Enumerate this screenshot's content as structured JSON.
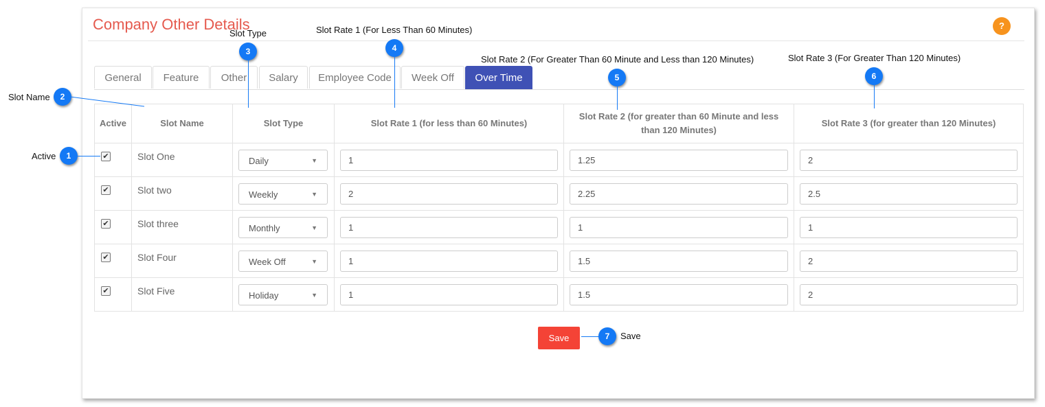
{
  "page": {
    "title": "Company Other Details",
    "help_label": "?"
  },
  "tabs": [
    {
      "label": "General",
      "active": false
    },
    {
      "label": "Feature",
      "active": false
    },
    {
      "label": "Other",
      "active": false
    },
    {
      "label": "Salary",
      "active": false
    },
    {
      "label": "Employee Code",
      "active": false
    },
    {
      "label": "Week Off",
      "active": false
    },
    {
      "label": "Over Time",
      "active": true
    }
  ],
  "table": {
    "headers": {
      "active": "Active",
      "slot_name": "Slot Name",
      "slot_type": "Slot Type",
      "rate1": "Slot Rate 1 (for less than 60 Minutes)",
      "rate2": "Slot Rate 2 (for greater than 60 Minute and less than 120 Minutes)",
      "rate3": "Slot Rate 3 (for greater than 120 Minutes)"
    },
    "rows": [
      {
        "active": true,
        "name": "Slot One",
        "type": "Daily",
        "rate1": "1",
        "rate2": "1.25",
        "rate3": "2"
      },
      {
        "active": true,
        "name": "Slot two",
        "type": "Weekly",
        "rate1": "2",
        "rate2": "2.25",
        "rate3": "2.5"
      },
      {
        "active": true,
        "name": "Slot three",
        "type": "Monthly",
        "rate1": "1",
        "rate2": "1",
        "rate3": "1"
      },
      {
        "active": true,
        "name": "Slot Four",
        "type": "Week Off",
        "rate1": "1",
        "rate2": "1.5",
        "rate3": "2"
      },
      {
        "active": true,
        "name": "Slot Five",
        "type": "Holiday",
        "rate1": "1",
        "rate2": "1.5",
        "rate3": "2"
      }
    ]
  },
  "save_label": "Save",
  "callouts": {
    "c1": {
      "num": "1",
      "label": "Active"
    },
    "c2": {
      "num": "2",
      "label": "Slot Name"
    },
    "c3": {
      "num": "3",
      "label": "Slot Type"
    },
    "c4": {
      "num": "4",
      "label": "Slot Rate 1 (For Less Than 60 Minutes)"
    },
    "c5": {
      "num": "5",
      "label": "Slot Rate 2 (For Greater Than 60 Minute and Less than 120 Minutes)"
    },
    "c6": {
      "num": "6",
      "label": "Slot Rate 3 (For Greater Than 120 Minutes)"
    },
    "c7": {
      "num": "7",
      "label": "Save"
    }
  },
  "colors": {
    "title": "#e55a4e",
    "tab_active": "#3f51b5",
    "save_button": "#f44336",
    "help_button": "#f7931e",
    "callout_badge": "#1479f5"
  }
}
